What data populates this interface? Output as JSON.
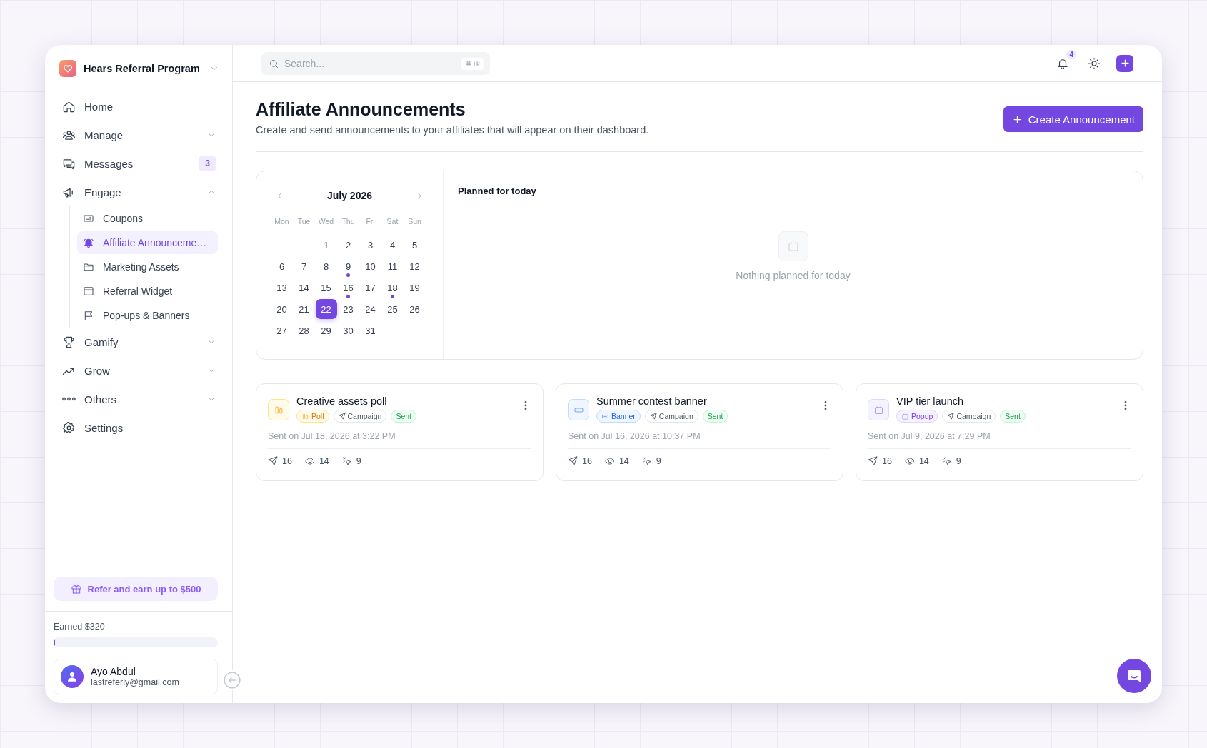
{
  "sidebar": {
    "brand": "Hears Referral Program",
    "nav": [
      {
        "kind": "link",
        "label": "Home",
        "selected": false
      },
      {
        "kind": "group",
        "label": "Manage",
        "selected": false,
        "expanded": false
      },
      {
        "kind": "link",
        "label": "Messages",
        "selected": false,
        "badge": "3"
      },
      {
        "kind": "group",
        "label": "Engage",
        "selected": false,
        "expanded": true,
        "children": [
          {
            "label": "Coupons",
            "selected": false
          },
          {
            "label": "Affiliate Announceme…",
            "selected": true
          },
          {
            "label": "Marketing Assets",
            "selected": false
          },
          {
            "label": "Referral Widget",
            "selected": false
          },
          {
            "label": "Pop-ups & Banners",
            "selected": false
          }
        ]
      },
      {
        "kind": "group",
        "label": "Gamify",
        "selected": false,
        "expanded": false
      },
      {
        "kind": "group",
        "label": "Grow",
        "selected": false,
        "expanded": false
      },
      {
        "kind": "group",
        "label": "Others",
        "selected": false,
        "expanded": false
      },
      {
        "kind": "link",
        "label": "Settings",
        "selected": false
      }
    ],
    "refer_button": "Refer and earn up to $500",
    "earned": {
      "label": "Earned $320",
      "level": 0.01
    },
    "user": {
      "name": "Ayo Abdul",
      "email": "lastreferly@gmail.com"
    }
  },
  "topbar": {
    "search": {
      "placeholder": "Search...",
      "shortcut": "⌘+k"
    },
    "notifications_badge": "4"
  },
  "header": {
    "title": "Affiliate Announcements",
    "subtitle": "Create and send announcements to your affiliates that will appear on their dashboard.",
    "button": "Create Announcement"
  },
  "calendar": {
    "month": "July 2026",
    "weekdays": [
      "Mon",
      "Tue",
      "Wed",
      "Thu",
      "Fri",
      "Sat",
      "Sun"
    ],
    "weeks": [
      {
        "days": [
          {
            "day": "1",
            "selected": false,
            "has_event": false
          },
          {
            "day": "2",
            "selected": false,
            "has_event": false
          },
          {
            "day": "3",
            "selected": false,
            "has_event": false
          },
          {
            "day": "4",
            "selected": false,
            "has_event": false
          },
          {
            "day": "5",
            "selected": false,
            "has_event": false
          }
        ]
      },
      {
        "days": [
          {
            "day": "6",
            "selected": false,
            "has_event": false
          },
          {
            "day": "7",
            "selected": false,
            "has_event": false
          },
          {
            "day": "8",
            "selected": false,
            "has_event": false
          },
          {
            "day": "9",
            "selected": false,
            "has_event": true
          },
          {
            "day": "10",
            "selected": false,
            "has_event": false
          },
          {
            "day": "11",
            "selected": false,
            "has_event": false
          },
          {
            "day": "12",
            "selected": false,
            "has_event": false
          }
        ]
      },
      {
        "days": [
          {
            "day": "13",
            "selected": false,
            "has_event": false
          },
          {
            "day": "14",
            "selected": false,
            "has_event": false
          },
          {
            "day": "15",
            "selected": false,
            "has_event": false
          },
          {
            "day": "16",
            "selected": false,
            "has_event": true
          },
          {
            "day": "17",
            "selected": false,
            "has_event": false
          },
          {
            "day": "18",
            "selected": false,
            "has_event": true
          },
          {
            "day": "19",
            "selected": false,
            "has_event": false
          }
        ]
      },
      {
        "days": [
          {
            "day": "20",
            "selected": false,
            "has_event": false
          },
          {
            "day": "21",
            "selected": false,
            "has_event": false
          },
          {
            "day": "22",
            "selected": true,
            "has_event": false
          },
          {
            "day": "23",
            "selected": false,
            "has_event": false
          },
          {
            "day": "24",
            "selected": false,
            "has_event": false
          },
          {
            "day": "25",
            "selected": false,
            "has_event": false
          },
          {
            "day": "26",
            "selected": false,
            "has_event": false
          }
        ]
      },
      {
        "days": [
          {
            "day": "27",
            "selected": false,
            "has_event": false
          },
          {
            "day": "28",
            "selected": false,
            "has_event": false
          },
          {
            "day": "29",
            "selected": false,
            "has_event": false
          },
          {
            "day": "30",
            "selected": false,
            "has_event": false
          },
          {
            "day": "31",
            "selected": false,
            "has_event": false
          }
        ]
      }
    ]
  },
  "planned": {
    "title": "Planned for today",
    "empty_text": "Nothing planned for today"
  },
  "announcements": [
    {
      "title": "Creative assets poll",
      "type": {
        "kind": "poll",
        "label": "Poll"
      },
      "channel": "Campaign",
      "status": "Sent",
      "sent": "Sent on Jul 18, 2026 at 3:22 PM",
      "sends": "16",
      "views": "14",
      "clicks": "9"
    },
    {
      "title": "Summer contest banner",
      "type": {
        "kind": "banner",
        "label": "Banner"
      },
      "channel": "Campaign",
      "status": "Sent",
      "sent": "Sent on Jul 16, 2026 at 10:37 PM",
      "sends": "16",
      "views": "14",
      "clicks": "9"
    },
    {
      "title": "VIP tier launch",
      "type": {
        "kind": "popup",
        "label": "Popup"
      },
      "channel": "Campaign",
      "status": "Sent",
      "sent": "Sent on Jul 9, 2026 at 7:29 PM",
      "sends": "16",
      "views": "14",
      "clicks": "9"
    }
  ]
}
